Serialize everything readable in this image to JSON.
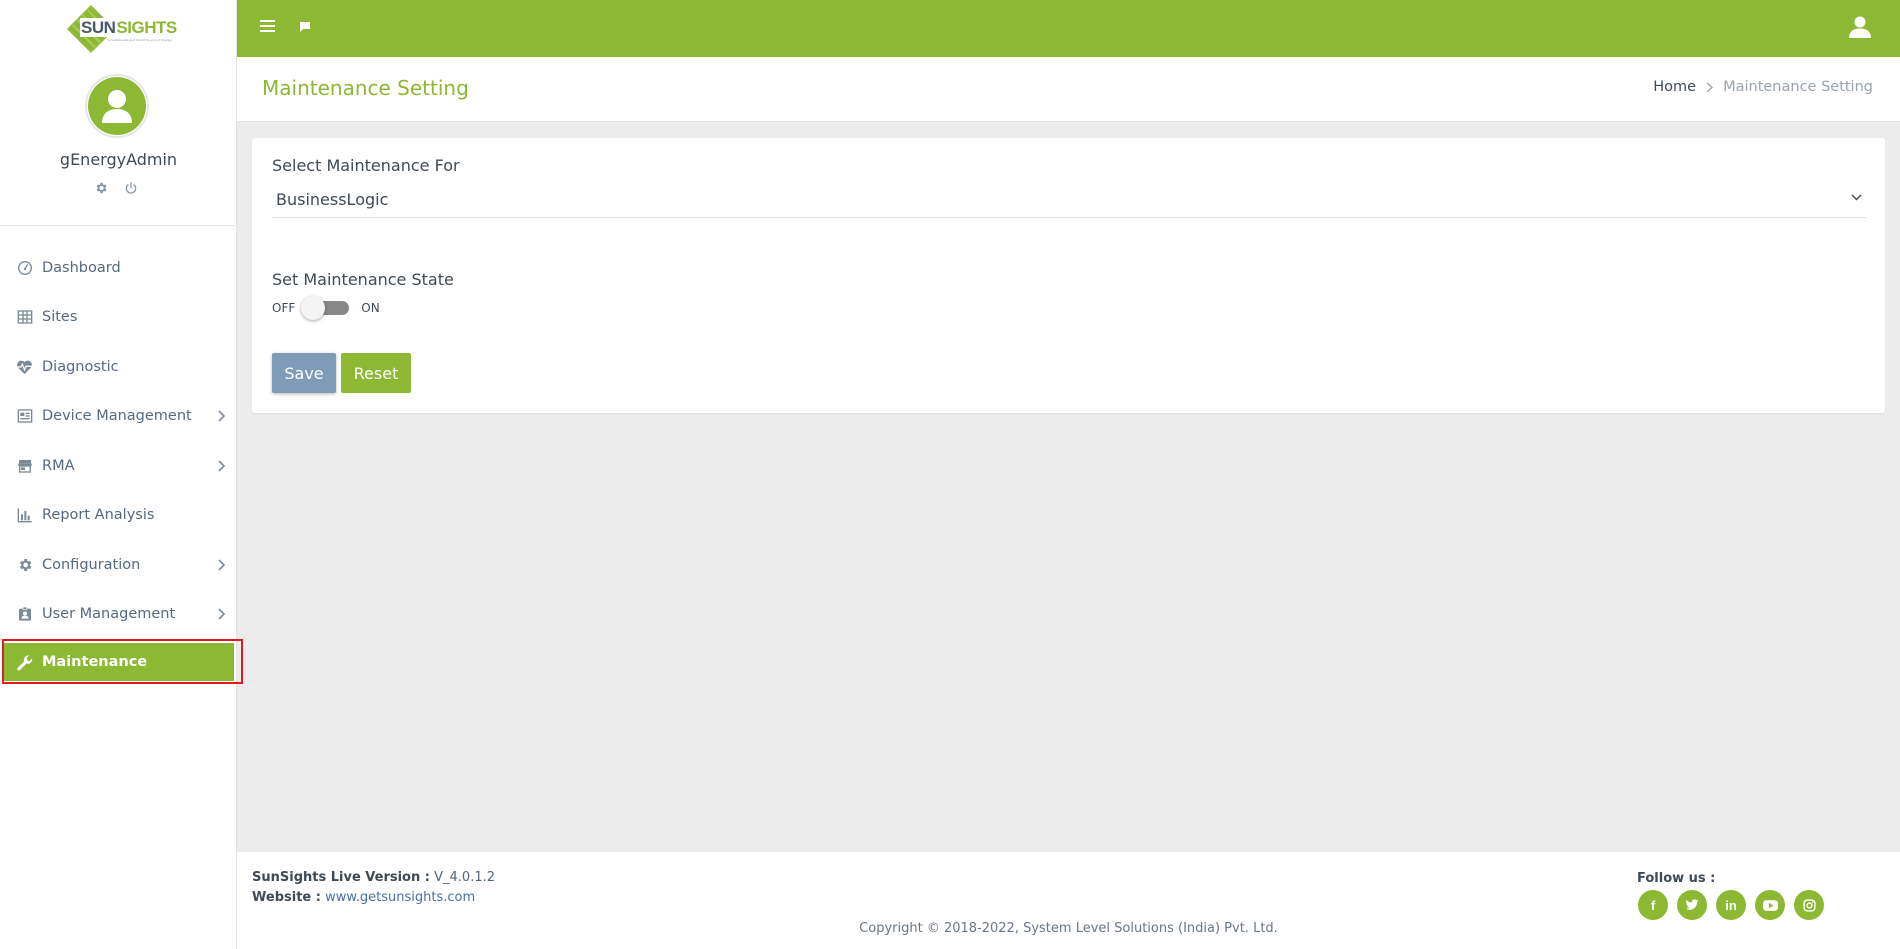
{
  "brand": {
    "logo_sun": "SUN",
    "logo_sights": "SIGHTS",
    "tagline": "A Sustainable and Smart Source of Energy",
    "accent_color": "#8db833"
  },
  "user": {
    "name": "gEnergyAdmin"
  },
  "sidebar": {
    "items": [
      {
        "label": "Dashboard",
        "icon": "dashboard-icon",
        "has_submenu": false
      },
      {
        "label": "Sites",
        "icon": "sites-icon",
        "has_submenu": false
      },
      {
        "label": "Diagnostic",
        "icon": "heartbeat-icon",
        "has_submenu": false
      },
      {
        "label": "Device Management",
        "icon": "device-icon",
        "has_submenu": true
      },
      {
        "label": "RMA",
        "icon": "store-icon",
        "has_submenu": true
      },
      {
        "label": "Report Analysis",
        "icon": "bar-chart-icon",
        "has_submenu": false
      },
      {
        "label": "Configuration",
        "icon": "gear-icon",
        "has_submenu": true
      },
      {
        "label": "User Management",
        "icon": "badge-icon",
        "has_submenu": true
      },
      {
        "label": "Maintenance",
        "icon": "wrench-icon",
        "has_submenu": false,
        "active": true
      }
    ]
  },
  "page": {
    "title": "Maintenance Setting",
    "breadcrumb_home": "Home",
    "breadcrumb_current": "Maintenance Setting"
  },
  "form": {
    "select_label": "Select Maintenance For",
    "select_value": "BusinessLogic",
    "state_label": "Set Maintenance State",
    "toggle_off_label": "OFF",
    "toggle_on_label": "ON",
    "toggle_state": "off",
    "save_label": "Save",
    "reset_label": "Reset"
  },
  "footer": {
    "version_label": "SunSights Live Version :",
    "version_value": "V_4.0.1.2",
    "website_label": "Website :",
    "website_value": "www.getsunsights.com",
    "copyright": "Copyright © 2018-2022, System Level Solutions (India) Pvt. Ltd.",
    "follow_label": "Follow us :",
    "socials": [
      {
        "label": "f",
        "icon": "facebook-icon"
      },
      {
        "label": "twitter",
        "icon": "twitter-icon"
      },
      {
        "label": "in",
        "icon": "linkedin-icon"
      },
      {
        "label": "youtube",
        "icon": "youtube-icon"
      },
      {
        "label": "instagram",
        "icon": "instagram-icon"
      }
    ]
  }
}
